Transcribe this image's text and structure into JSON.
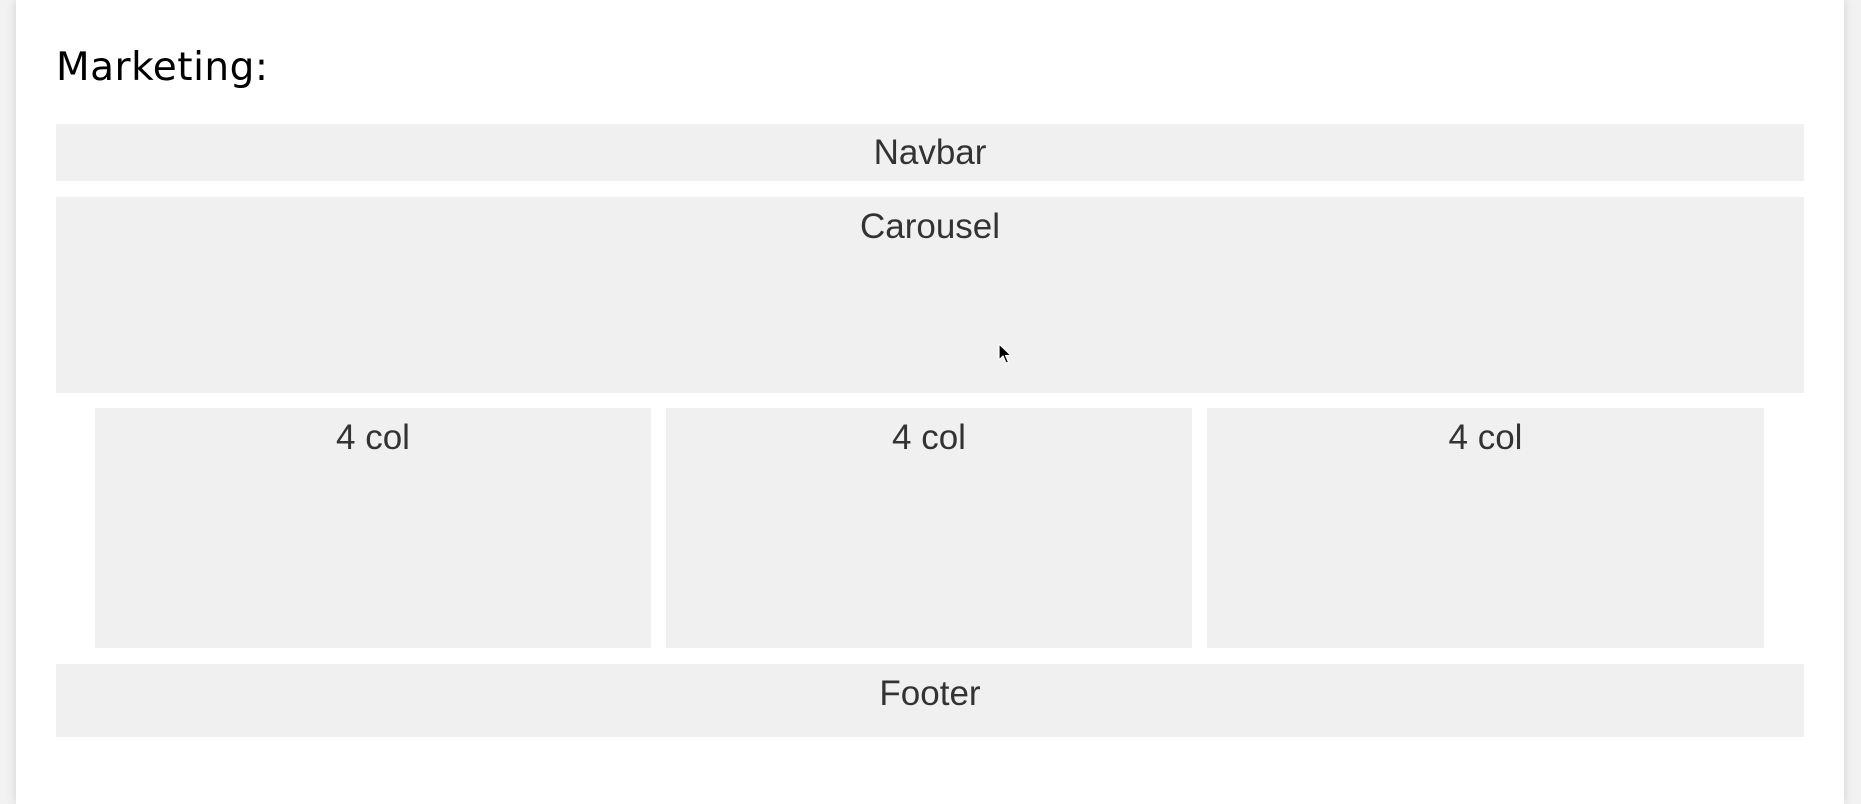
{
  "section": {
    "title": "Marketing:"
  },
  "layout_blocks": {
    "navbar": "Navbar",
    "carousel": "Carousel",
    "columns": [
      "4 col",
      "4 col",
      "4 col"
    ],
    "footer": "Footer"
  },
  "colors": {
    "page_background": "#ffffff",
    "outer_background": "#f2f2f2",
    "block_background": "#f0f0f0",
    "block_text": "#333333",
    "title_text": "#000000"
  },
  "icons": {
    "cursor": "mouse-pointer-icon"
  }
}
